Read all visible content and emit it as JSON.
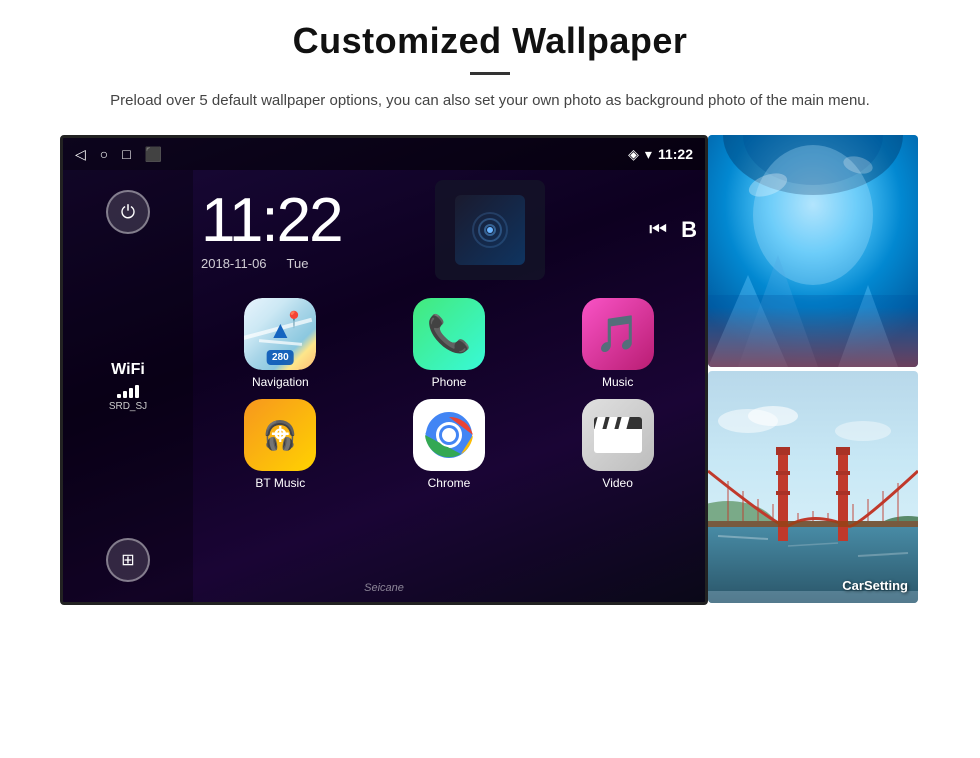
{
  "header": {
    "title": "Customized Wallpaper",
    "description": "Preload over 5 default wallpaper options, you can also set your own photo as background photo of the main menu."
  },
  "android": {
    "status_bar": {
      "back_icon": "◁",
      "home_icon": "○",
      "recents_icon": "□",
      "screenshot_icon": "⬛",
      "location_icon": "📍",
      "wifi_icon": "▾",
      "time": "11:22"
    },
    "clock": {
      "time": "11:22",
      "date": "2018-11-06",
      "day": "Tue"
    },
    "sidebar": {
      "wifi_label": "WiFi",
      "wifi_ssid": "SRD_SJ"
    },
    "apps": [
      {
        "id": "navigation",
        "label": "Navigation",
        "icon_type": "navigation"
      },
      {
        "id": "phone",
        "label": "Phone",
        "icon_type": "phone"
      },
      {
        "id": "music",
        "label": "Music",
        "icon_type": "music"
      },
      {
        "id": "btmusic",
        "label": "BT Music",
        "icon_type": "btmusic"
      },
      {
        "id": "chrome",
        "label": "Chrome",
        "icon_type": "chrome"
      },
      {
        "id": "video",
        "label": "Video",
        "icon_type": "video"
      }
    ],
    "extra_app": {
      "label": "CarSetting",
      "visible": true
    }
  },
  "wallpapers": {
    "top_alt": "Ice cave wallpaper",
    "bottom_alt": "Golden Gate Bridge wallpaper"
  },
  "watermark": "Seicane"
}
